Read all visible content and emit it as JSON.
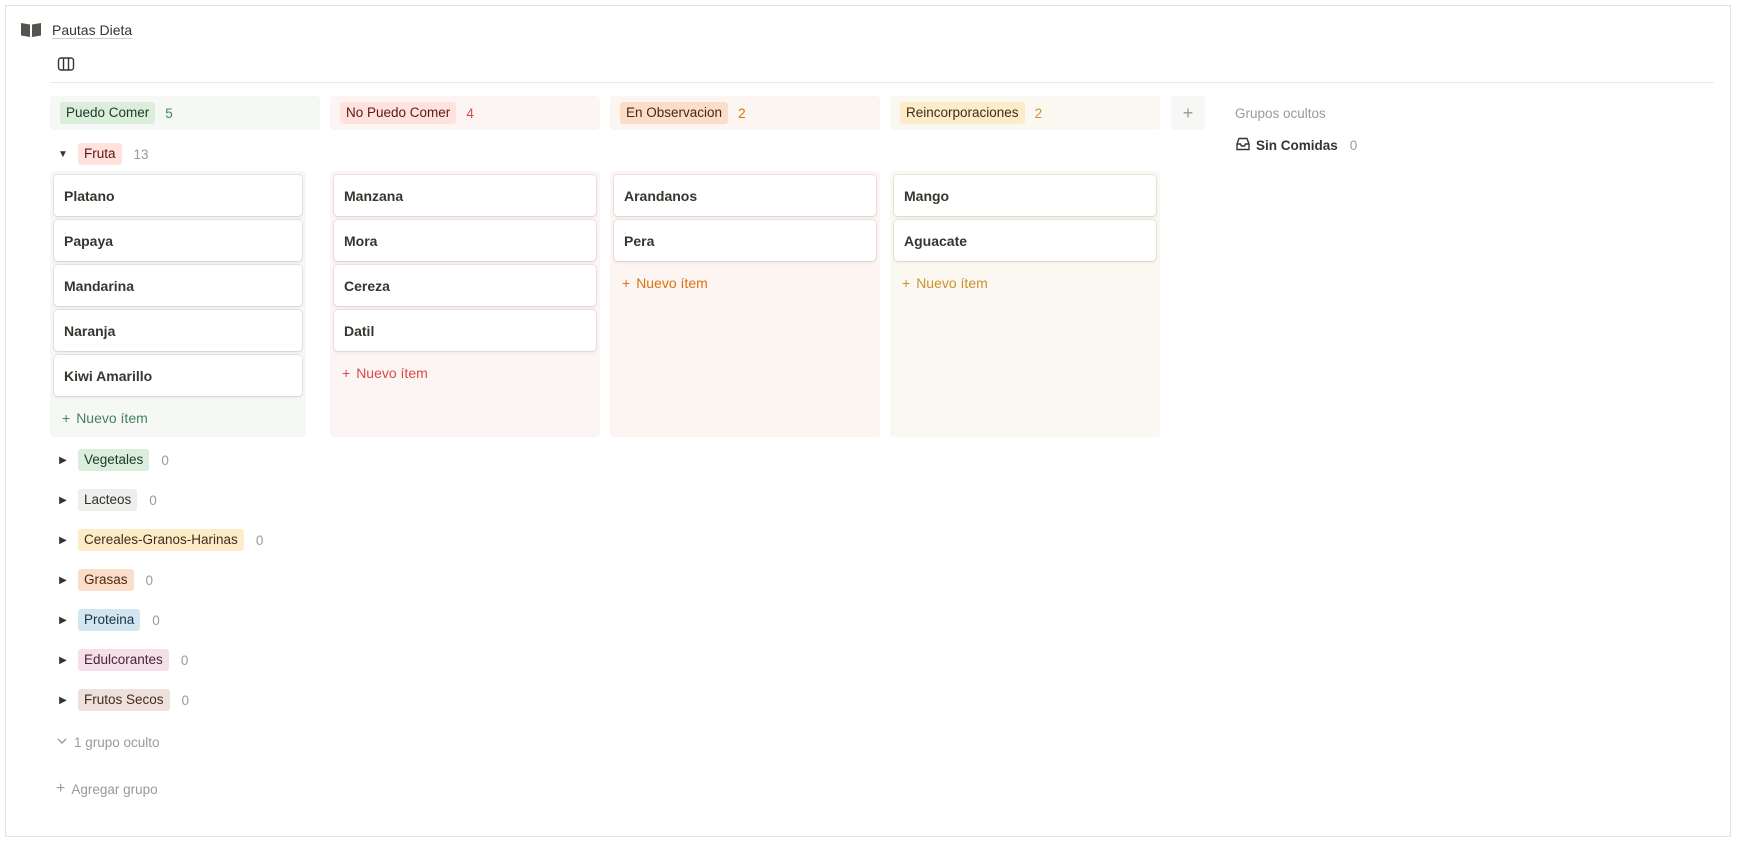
{
  "page": {
    "title": "Pautas Dieta"
  },
  "columns": [
    {
      "label": "Puedo Comer",
      "count": "5",
      "bg": "#f6f8f5",
      "tag_bg": "#dbeddb",
      "tag_color": "#1c3829",
      "count_color": "#448361"
    },
    {
      "label": "No Puedo Comer",
      "count": "4",
      "bg": "#fdf5f4",
      "tag_bg": "#ffe2dd",
      "tag_color": "#5d1715",
      "count_color": "#d44c47"
    },
    {
      "label": "En Observacion",
      "count": "2",
      "bg": "#fcf5f2",
      "tag_bg": "#fadec9",
      "tag_color": "#49290e",
      "count_color": "#d9730d"
    },
    {
      "label": "Reincorporaciones",
      "count": "2",
      "bg": "#fbf8f1",
      "tag_bg": "#fdecc8",
      "tag_color": "#402c1b",
      "count_color": "#cb912f"
    }
  ],
  "add_column_label": "+",
  "hidden_groups": {
    "title": "Grupos ocultos",
    "items": [
      {
        "label": "Sin Comidas",
        "count": "0"
      }
    ]
  },
  "expanded_group": {
    "label": "Fruta",
    "count": "13",
    "tag_bg": "#ffe2dd",
    "tag_color": "#5d1715"
  },
  "lanes": [
    {
      "cards": [
        "Platano",
        "Papaya",
        "Mandarina",
        "Naranja",
        "Kiwi Amarillo"
      ],
      "new_label": "Nuevo ítem",
      "new_color": "#448361"
    },
    {
      "cards": [
        "Manzana",
        "Mora",
        "Cereza",
        "Datil"
      ],
      "new_label": "Nuevo ítem",
      "new_color": "#d44c47"
    },
    {
      "cards": [
        "Arandanos",
        "Pera"
      ],
      "new_label": "Nuevo ítem",
      "new_color": "#d9730d"
    },
    {
      "cards": [
        "Mango",
        "Aguacate"
      ],
      "new_label": "Nuevo ítem",
      "new_color": "#cb912f"
    }
  ],
  "collapsed_groups": [
    {
      "label": "Vegetales",
      "count": "0",
      "tag_bg": "#dbeddb",
      "tag_color": "#1c3829"
    },
    {
      "label": "Lacteos",
      "count": "0",
      "tag_bg": "#eeeeed",
      "tag_color": "#32302c"
    },
    {
      "label": "Cereales-Granos-Harinas",
      "count": "0",
      "tag_bg": "#fdecc8",
      "tag_color": "#402c1b"
    },
    {
      "label": "Grasas",
      "count": "0",
      "tag_bg": "#fadec9",
      "tag_color": "#49290e"
    },
    {
      "label": "Proteina",
      "count": "0",
      "tag_bg": "#d3e5ef",
      "tag_color": "#183347"
    },
    {
      "label": "Edulcorantes",
      "count": "0",
      "tag_bg": "#f5e0e9",
      "tag_color": "#4c2337"
    },
    {
      "label": "Frutos Secos",
      "count": "0",
      "tag_bg": "#eee0da",
      "tag_color": "#442a1e"
    }
  ],
  "footer": {
    "hidden_group_label": "1 grupo oculto",
    "add_group_label": "Agregar grupo"
  }
}
